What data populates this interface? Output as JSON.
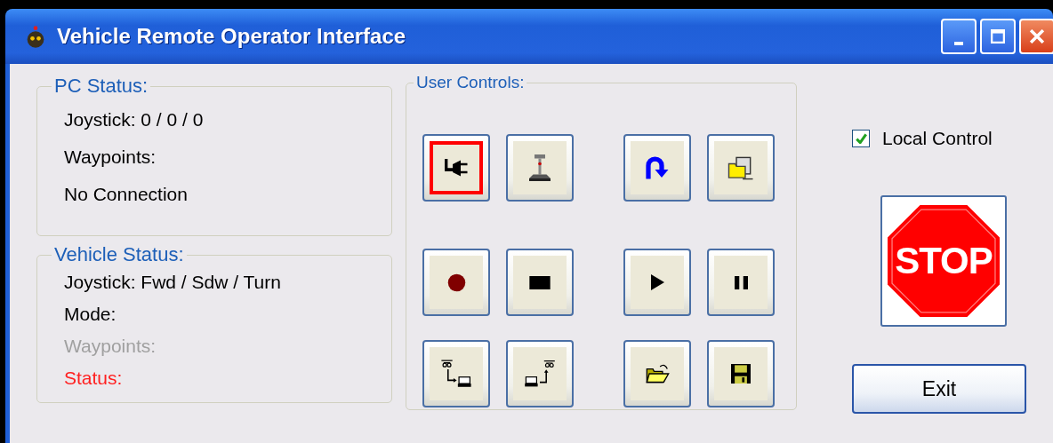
{
  "window": {
    "title": "Vehicle Remote Operator Interface"
  },
  "pc_status": {
    "title": "PC Status:",
    "lines": [
      "Joystick: 0 / 0 / 0",
      "Waypoints:",
      "No Connection"
    ]
  },
  "vehicle_status": {
    "title": "Vehicle Status:",
    "lines": [
      {
        "text": "Joystick: Fwd / Sdw / Turn",
        "kind": "normal"
      },
      {
        "text": "Mode:",
        "kind": "normal"
      },
      {
        "text": "Waypoints:",
        "kind": "disabled"
      },
      {
        "text": "Status:",
        "kind": "error"
      }
    ]
  },
  "user_controls": {
    "title": "User Controls:",
    "rows": [
      [
        {
          "kind": "plug",
          "active": true
        },
        {
          "kind": "joystick",
          "active": false
        },
        {
          "kind": "uturn",
          "active": false
        },
        {
          "kind": "network-folder",
          "active": false
        }
      ],
      [
        {
          "kind": "record",
          "active": false
        },
        {
          "kind": "stop",
          "active": false
        },
        {
          "kind": "play",
          "active": false
        },
        {
          "kind": "pause",
          "active": false
        }
      ],
      [
        {
          "kind": "download",
          "active": false
        },
        {
          "kind": "upload",
          "active": false
        },
        {
          "kind": "open",
          "active": false
        },
        {
          "kind": "save",
          "active": false
        }
      ]
    ]
  },
  "local_control": {
    "label": "Local Control",
    "checked": true
  },
  "stop_button": {
    "text": "STOP"
  },
  "exit_button": {
    "label": "Exit"
  }
}
